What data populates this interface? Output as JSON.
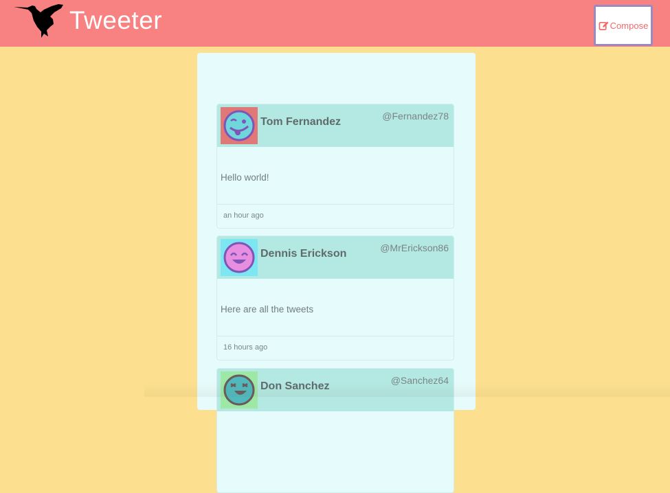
{
  "nav": {
    "brand": "Tweeter",
    "logo_icon": "hummingbird-icon",
    "compose_label": "Compose",
    "compose_icon": "edit-icon",
    "bg_color": "#f88181",
    "compose_border_color": "#9b8ac2"
  },
  "page": {
    "bg_color": "#fde08f",
    "container_color": "#e6fcfc",
    "tweet_header_color": "#b3e8e3"
  },
  "tweets": [
    {
      "name": "Tom Fernandez",
      "handle": "@Fernandez78",
      "content": "Hello world!",
      "time": "an hour ago",
      "avatar_icon": "tongue-out-face-icon",
      "avatar_bg": "#e07878"
    },
    {
      "name": "Dennis Erickson",
      "handle": "@MrErickson86",
      "content": "Here are all the tweets",
      "time": "16 hours ago",
      "avatar_icon": "smiling-face-icon",
      "avatar_bg": "#7ce6f2"
    },
    {
      "name": "Don Sanchez",
      "handle": "@Sanchez64",
      "content": "",
      "time": "",
      "avatar_icon": "laughing-face-icon",
      "avatar_bg": "#9ee8a6"
    }
  ]
}
